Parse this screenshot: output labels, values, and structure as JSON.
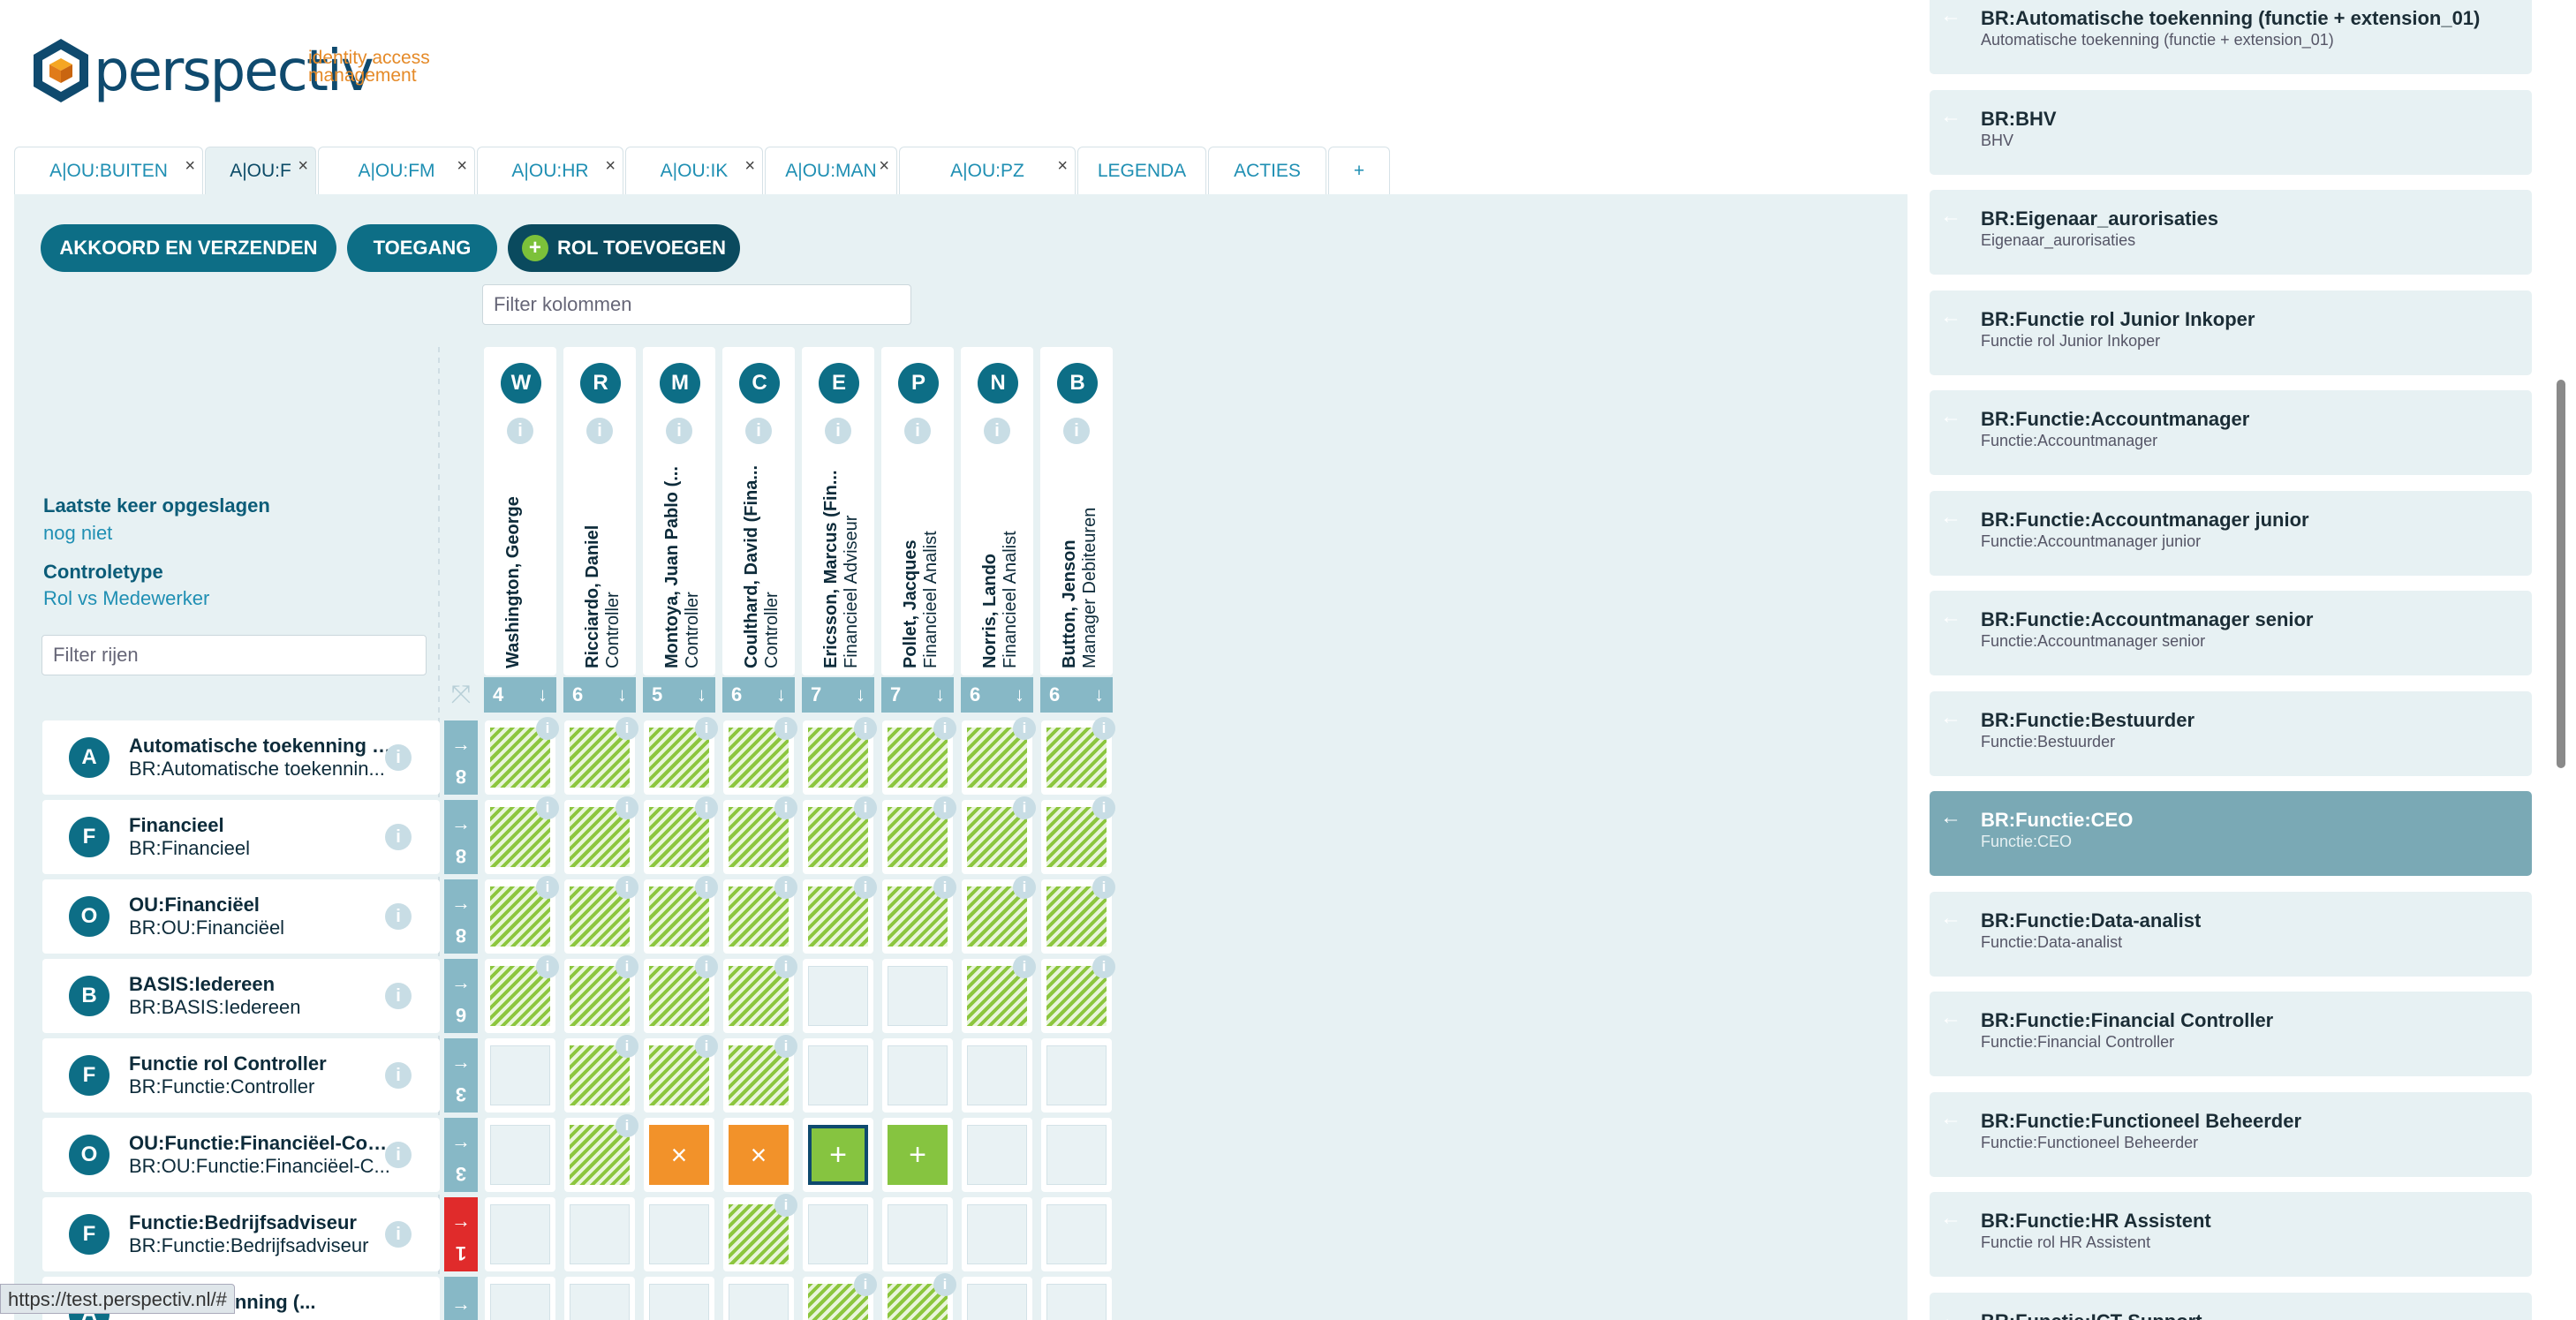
{
  "logo": {
    "word": "perspectiv",
    "slogan_line1": "identity access",
    "slogan_line2": "management"
  },
  "tabs": [
    {
      "label": "A|OU:BUITEN",
      "close": "×"
    },
    {
      "label": "A|OU:F",
      "close": "×"
    },
    {
      "label": "A|OU:FM",
      "close": "×"
    },
    {
      "label": "A|OU:HR",
      "close": "×"
    },
    {
      "label": "A|OU:IK",
      "close": "×"
    },
    {
      "label": "A|OU:MAN",
      "close": "×"
    },
    {
      "label": "A|OU:PZ",
      "close": "×"
    },
    {
      "label": "LEGENDA",
      "close": ""
    },
    {
      "label": "ACTIES",
      "close": ""
    },
    {
      "label": "+",
      "close": ""
    }
  ],
  "buttons": {
    "akkoord": "AKKOORD EN VERZENDEN",
    "toegang": "TOEGANG",
    "rol_toevoegen": "ROL TOEVOEGEN",
    "plus": "+"
  },
  "filter_kolommen": {
    "placeholder": "Filter kolommen"
  },
  "filter_rijen": {
    "placeholder": "Filter rijen"
  },
  "info": {
    "saved_label": "Laatste keer opgeslagen",
    "saved_value": "nog niet",
    "type_label": "Controletype",
    "type_value": "Rol vs Medewerker"
  },
  "info_glyph": "i",
  "columns": [
    {
      "initial": "W",
      "name": "Washington, George",
      "role": "",
      "count": "4",
      "arrow": "↓"
    },
    {
      "initial": "R",
      "name": "Ricciardo, Daniel",
      "role": "Controller",
      "count": "6",
      "arrow": "↓"
    },
    {
      "initial": "M",
      "name": "Montoya, Juan Pablo (...",
      "role": "Controller",
      "count": "5",
      "arrow": "↓"
    },
    {
      "initial": "C",
      "name": "Coulthard, David (Fina...",
      "role": "Controller",
      "count": "6",
      "arrow": "↓"
    },
    {
      "initial": "E",
      "name": "Ericsson, Marcus (Fin...",
      "role": "Financieel Adviseur",
      "count": "7",
      "arrow": "↓"
    },
    {
      "initial": "P",
      "name": "Pollet, Jacques",
      "role": "Financieel Analist",
      "count": "7",
      "arrow": "↓"
    },
    {
      "initial": "N",
      "name": "Norris, Lando",
      "role": "Financieel Analist",
      "count": "6",
      "arrow": "↓"
    },
    {
      "initial": "B",
      "name": "Button, Jenson",
      "role": "Manager Debiteuren",
      "count": "6",
      "arrow": "↓"
    }
  ],
  "corner_icon": "⤧",
  "rows": [
    {
      "initial": "A",
      "title": "Automatische toekenning (...",
      "sub": "BR:Automatische toekennin...",
      "count": "8",
      "arrow": "→"
    },
    {
      "initial": "F",
      "title": "Financieel",
      "sub": "BR:Financieel",
      "count": "8",
      "arrow": "→"
    },
    {
      "initial": "O",
      "title": "OU:Financiëel",
      "sub": "BR:OU:Financiëel",
      "count": "8",
      "arrow": "→"
    },
    {
      "initial": "B",
      "title": "BASIS:Iedereen",
      "sub": "BR:BASIS:Iedereen",
      "count": "6",
      "arrow": "→"
    },
    {
      "initial": "F",
      "title": "Functie rol Controller",
      "sub": "BR:Functie:Controller",
      "count": "3",
      "arrow": "→"
    },
    {
      "initial": "O",
      "title": "OU:Functie:Financiëel-Con...",
      "sub": "BR:OU:Functie:Financiëel-C...",
      "count": "3",
      "arrow": "→"
    },
    {
      "initial": "F",
      "title": "Functie:Bedrijfsadviseur",
      "sub": "BR:Functie:Bedrijfsadviseur",
      "count": "1",
      "arrow": "→"
    },
    {
      "initial": "A",
      "title": "...che toekenning (...",
      "sub": "",
      "count": "",
      "arrow": "→"
    }
  ],
  "grid": [
    [
      "h",
      "h",
      "h",
      "h",
      "h",
      "h",
      "h",
      "h"
    ],
    [
      "h",
      "h",
      "h",
      "h",
      "h",
      "h",
      "h",
      "h"
    ],
    [
      "h",
      "h",
      "h",
      "h",
      "h",
      "h",
      "h",
      "h"
    ],
    [
      "h",
      "h",
      "h",
      "h",
      "e",
      "e",
      "h",
      "h"
    ],
    [
      "e",
      "h",
      "h",
      "h",
      "e",
      "e",
      "e",
      "e"
    ],
    [
      "e",
      "h",
      "x",
      "x",
      "ps",
      "p",
      "e",
      "e"
    ],
    [
      "e",
      "e",
      "e",
      "h",
      "e",
      "e",
      "e",
      "e"
    ],
    [
      "e",
      "e",
      "e",
      "e",
      "h",
      "h",
      "e",
      "e"
    ]
  ],
  "cell_glyphs": {
    "x": "×",
    "p": "+"
  },
  "right_panel": {
    "arrow": "←",
    "items": [
      {
        "title": "BR:Automatische toekenning (functie + extension_01)",
        "sub": "Automatische toekenning (functie + extension_01)"
      },
      {
        "title": "BR:BHV",
        "sub": "BHV"
      },
      {
        "title": "BR:Eigenaar_aurorisaties",
        "sub": "Eigenaar_aurorisaties"
      },
      {
        "title": "BR:Functie rol Junior Inkoper",
        "sub": "Functie rol Junior Inkoper"
      },
      {
        "title": "BR:Functie:Accountmanager",
        "sub": "Functie:Accountmanager"
      },
      {
        "title": "BR:Functie:Accountmanager junior",
        "sub": "Functie:Accountmanager junior"
      },
      {
        "title": "BR:Functie:Accountmanager senior",
        "sub": "Functie:Accountmanager senior"
      },
      {
        "title": "BR:Functie:Bestuurder",
        "sub": "Functie:Bestuurder"
      },
      {
        "title": "BR:Functie:CEO",
        "sub": "Functie:CEO",
        "active": true
      },
      {
        "title": "BR:Functie:Data-analist",
        "sub": "Functie:Data-analist"
      },
      {
        "title": "BR:Functie:Financial Controller",
        "sub": "Functie:Financial Controller"
      },
      {
        "title": "BR:Functie:Functioneel Beheerder",
        "sub": "Functie:Functioneel Beheerder"
      },
      {
        "title": "BR:Functie:HR Assistent",
        "sub": "Functie rol HR Assistent"
      },
      {
        "title": "BR:Functie:ICT Support",
        "sub": ""
      }
    ]
  },
  "status_url": "https://test.perspectiv.nl/#"
}
